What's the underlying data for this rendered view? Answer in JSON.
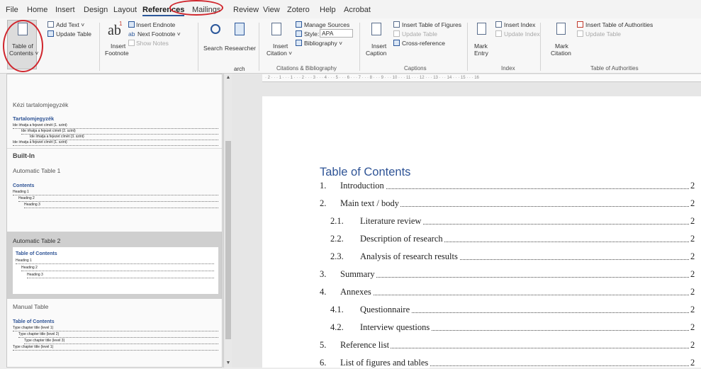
{
  "tabs": [
    "File",
    "Home",
    "Insert",
    "Design",
    "Layout",
    "References",
    "Mailings",
    "Review",
    "View",
    "Zotero",
    "Help",
    "Acrobat"
  ],
  "ribbon": {
    "toc_btn": [
      "Table of",
      "Contents ˅"
    ],
    "add_text": "Add Text ˅",
    "update_table": "Update Table",
    "insert_footnote": [
      "Insert",
      "Footnote"
    ],
    "insert_endnote": "Insert Endnote",
    "next_footnote": "Next Footnote ˅",
    "show_notes": "Show Notes",
    "search": "Search",
    "researcher": "Researcher",
    "insert_citation": [
      "Insert",
      "Citation ˅"
    ],
    "manage_sources": "Manage Sources",
    "style": "Style:",
    "style_value": "APA",
    "bibliography": "Bibliography ˅",
    "citations_group": "Citations & Bibliography",
    "insert_caption": [
      "Insert",
      "Caption"
    ],
    "insert_table_figures": "Insert Table of Figures",
    "update_table_dim": "Update Table",
    "cross_reference": "Cross-reference",
    "captions_group": "Captions",
    "mark_entry": [
      "Mark",
      "Entry"
    ],
    "insert_index": "Insert Index",
    "update_index": "Update Index",
    "index_group": "Index",
    "mark_citation": [
      "Mark",
      "Citation"
    ],
    "insert_toa": "Insert Table of Authorities",
    "update_table_toa": "Update Table",
    "toa_group": "Table of Authorities",
    "arch": "arch"
  },
  "gallery": {
    "section_custom": "Kézi tartalomjegyzék",
    "custom_title": "Tartalomjegyzék",
    "custom_lines": [
      "Ide írhatja a fejezet címét (1. szint)",
      "Ide írhatja a fejezet címét (2. szint)",
      "Ide írhatja a fejezet címét (3. szint)",
      "Ide írhatja a fejezet címét (1. szint)"
    ],
    "section_builtin": "Built-In",
    "auto1_label": "Automatic Table 1",
    "auto1_title": "Contents",
    "auto2_label": "Automatic Table 2",
    "auto2_title": "Table of Contents",
    "heading_lines": [
      "Heading 1",
      "Heading 2",
      "Heading 3"
    ],
    "manual_label": "Manual Table",
    "manual_title": "Table of Contents",
    "manual_lines": [
      "Type chapter title (level 1)",
      "Type chapter title (level 2)",
      "Type chapter title (level 3)",
      "Type chapter title (level 1)"
    ]
  },
  "ruler_text": "· 2 · · · 1 · · · 1 · · · 2 · · · 3 · · · 4 · · · 5 · · · 6 · · · 7 · · · 8 · · · 9 · · · 10 · · · 11 · · · 12 · · · 13 · · · 14 · · · 15 · · · 16",
  "toc": {
    "title": "Table of Contents",
    "entries": [
      {
        "num": "1.",
        "text": "Introduction",
        "page": "2"
      },
      {
        "num": "2.",
        "text": "Main text / body",
        "page": "2"
      },
      {
        "num": "2.1.",
        "text": "Literature review",
        "page": "2"
      },
      {
        "num": "2.2.",
        "text": "Description of research",
        "page": "2"
      },
      {
        "num": "2.3.",
        "text": "Analysis of research results",
        "page": "2"
      },
      {
        "num": "3.",
        "text": "Summary",
        "page": "2"
      },
      {
        "num": "4.",
        "text": "Annexes",
        "page": "2"
      },
      {
        "num": "4.1.",
        "text": "Questionnaire",
        "page": "2"
      },
      {
        "num": "4.2.",
        "text": "Interview questions",
        "page": "2"
      },
      {
        "num": "5.",
        "text": "Reference list",
        "page": "2"
      },
      {
        "num": "6.",
        "text": "List of figures and tables",
        "page": "2"
      }
    ]
  }
}
